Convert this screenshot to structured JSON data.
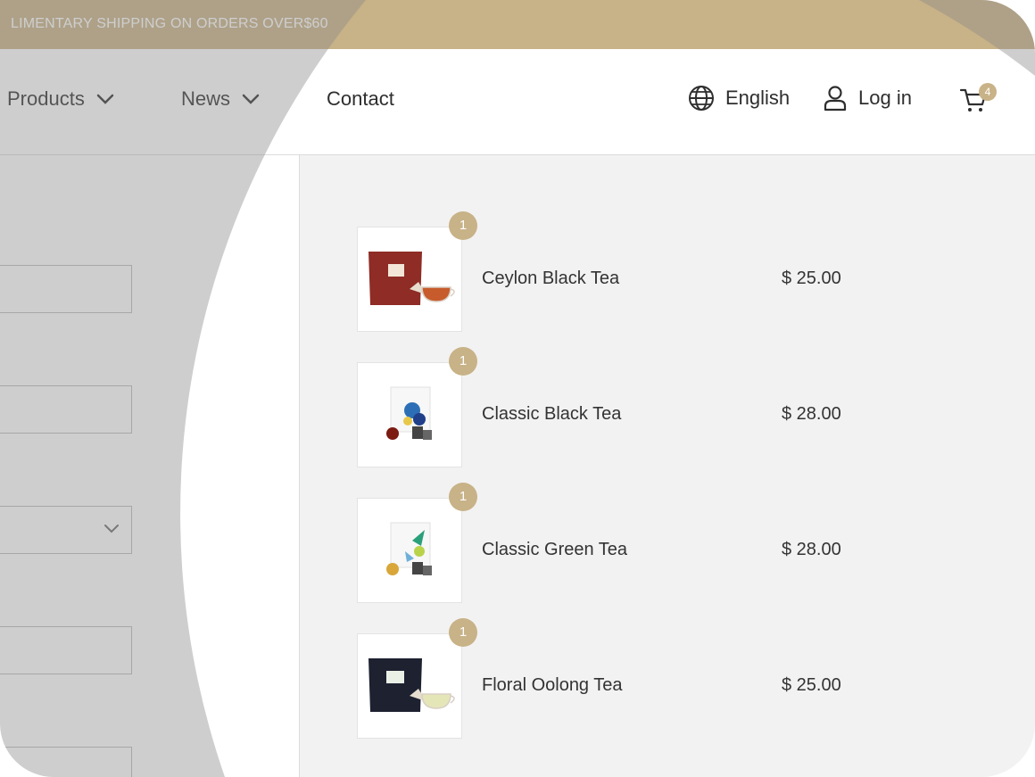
{
  "announcement": "LIMENTARY SHIPPING ON ORDERS OVER$60",
  "nav": {
    "products": "Products",
    "news": "News",
    "contact": "Contact",
    "language": "English",
    "login": "Log in",
    "cart_count": "4"
  },
  "order_items": [
    {
      "quantity": "1",
      "name": "Ceylon Black Tea",
      "price": "$ 25.00",
      "image": "ceylon-black-tea-pouch"
    },
    {
      "quantity": "1",
      "name": "Classic Black Tea",
      "price": "$ 28.00",
      "image": "classic-black-tea-box"
    },
    {
      "quantity": "1",
      "name": "Classic Green Tea",
      "price": "$ 28.00",
      "image": "classic-green-tea-box"
    },
    {
      "quantity": "1",
      "name": "Floral Oolong Tea",
      "price": "$ 25.00",
      "image": "floral-oolong-tea-pouch"
    }
  ],
  "colors": {
    "accent": "#c8b287",
    "summary_bg": "#f2f2f2",
    "text": "#2e2e2e",
    "overlay": "#8a8a8a"
  }
}
